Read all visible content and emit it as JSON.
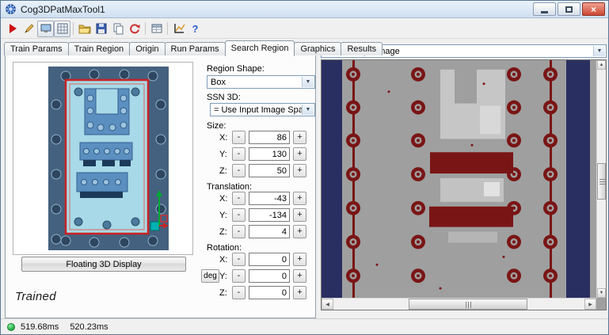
{
  "window": {
    "title": "Cog3DPatMaxTool1",
    "close_glyph": "×"
  },
  "toolbar": {
    "icons": [
      "run",
      "edit",
      "image-display",
      "pixel-grid",
      "open",
      "save",
      "copy",
      "reset",
      "results",
      "graph",
      "help"
    ],
    "help_glyph": "?"
  },
  "tabs": {
    "items": [
      "Train Params",
      "Train Region",
      "Origin",
      "Run Params",
      "Search Region",
      "Graphics",
      "Results"
    ],
    "active": "Search Region"
  },
  "left_panel": {
    "floating_button": "Floating 3D Display",
    "trained": "Trained"
  },
  "controls": {
    "region_shape": {
      "label": "Region Shape:",
      "value": "Box"
    },
    "ssn3d": {
      "label": "SSN 3D:",
      "value": "= Use Input Image Space"
    },
    "size": {
      "label": "Size:",
      "rows": [
        {
          "axis": "X:",
          "value": "86"
        },
        {
          "axis": "Y:",
          "value": "130"
        },
        {
          "axis": "Z:",
          "value": "50"
        }
      ]
    },
    "translation": {
      "label": "Translation:",
      "rows": [
        {
          "axis": "X:",
          "value": "-43"
        },
        {
          "axis": "Y:",
          "value": "-134"
        },
        {
          "axis": "Z:",
          "value": "4"
        }
      ]
    },
    "rotation": {
      "label": "Rotation:",
      "deg_button": "deg",
      "rows": [
        {
          "axis": "X:",
          "value": "0"
        },
        {
          "axis": "Y:",
          "value": "0"
        },
        {
          "axis": "Z:",
          "value": "0"
        }
      ]
    },
    "minus": "-",
    "plus": "+"
  },
  "right_panel": {
    "image_selector": "Current.InputImage"
  },
  "status": {
    "time1": "519.68ms",
    "time2": "520.23ms"
  },
  "ui": {
    "combo_arrow": "▼",
    "scroll_up": "▲",
    "scroll_down": "▼",
    "scroll_left": "◀",
    "scroll_right": "▶"
  },
  "colors": {
    "search_region_red": "#cc2222",
    "scene_background": "#44617f",
    "region_fill": "#a8d9e8",
    "part_blue": "#5b8fc0",
    "image_gray": "#9f9f9f",
    "image_red": "#7a1515",
    "image_navy": "#2a2f62",
    "status_green": "#2eb24e"
  }
}
